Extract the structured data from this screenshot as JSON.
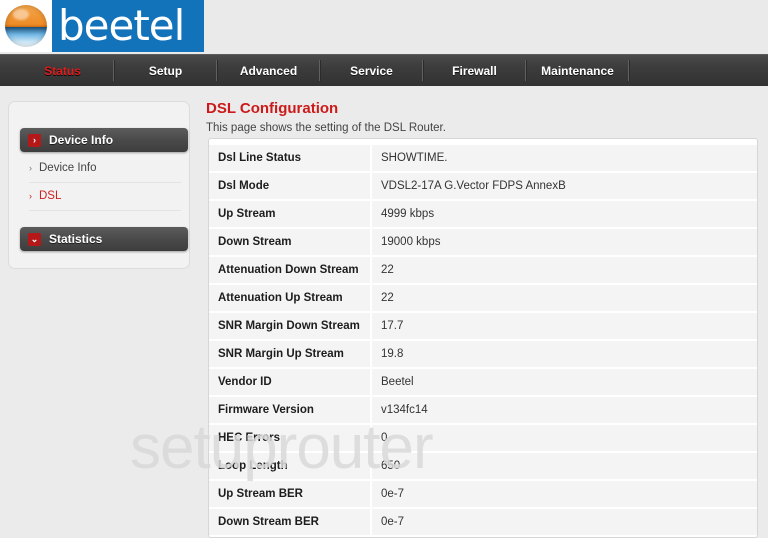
{
  "brand": {
    "name": "beetel",
    "logo_icon": "sphere-logo-icon",
    "bar_color": "#1273bb"
  },
  "nav": {
    "active_color": "#e01b1b",
    "items": [
      {
        "label": "Status",
        "active": true
      },
      {
        "label": "Setup",
        "active": false
      },
      {
        "label": "Advanced",
        "active": false
      },
      {
        "label": "Service",
        "active": false
      },
      {
        "label": "Firewall",
        "active": false
      },
      {
        "label": "Maintenance",
        "active": false
      }
    ]
  },
  "sidebar": {
    "sections": [
      {
        "label": "Device Info",
        "badge": "›"
      },
      {
        "label": "Statistics",
        "badge": "⌄"
      }
    ],
    "items": [
      {
        "label": "Device Info",
        "arrow": "›",
        "active": false
      },
      {
        "label": "DSL",
        "arrow": "›",
        "active": true
      }
    ]
  },
  "main": {
    "title": "DSL Configuration",
    "subtitle": "This page shows the setting of the DSL Router.",
    "title_color": "#cc1a1a",
    "table": {
      "rows": [
        {
          "label": "Dsl Line Status",
          "value": "SHOWTIME."
        },
        {
          "label": "Dsl Mode",
          "value": "VDSL2-17A G.Vector FDPS AnnexB"
        },
        {
          "label": "Up Stream",
          "value": "4999 kbps"
        },
        {
          "label": "Down Stream",
          "value": "19000 kbps"
        },
        {
          "label": "Attenuation Down Stream",
          "value": "22"
        },
        {
          "label": "Attenuation Up Stream",
          "value": "22"
        },
        {
          "label": "SNR Margin Down Stream",
          "value": "17.7"
        },
        {
          "label": "SNR Margin Up Stream",
          "value": "19.8"
        },
        {
          "label": "Vendor ID",
          "value": "Beetel"
        },
        {
          "label": "Firmware Version",
          "value": "v134fc14"
        },
        {
          "label": "HEC Errors",
          "value": "0"
        },
        {
          "label": "Loop Length",
          "value": "650"
        },
        {
          "label": "Up Stream BER",
          "value": "0e-7"
        },
        {
          "label": "Down Stream BER",
          "value": "0e-7"
        }
      ]
    }
  },
  "watermark": {
    "text": "setuprouter"
  }
}
